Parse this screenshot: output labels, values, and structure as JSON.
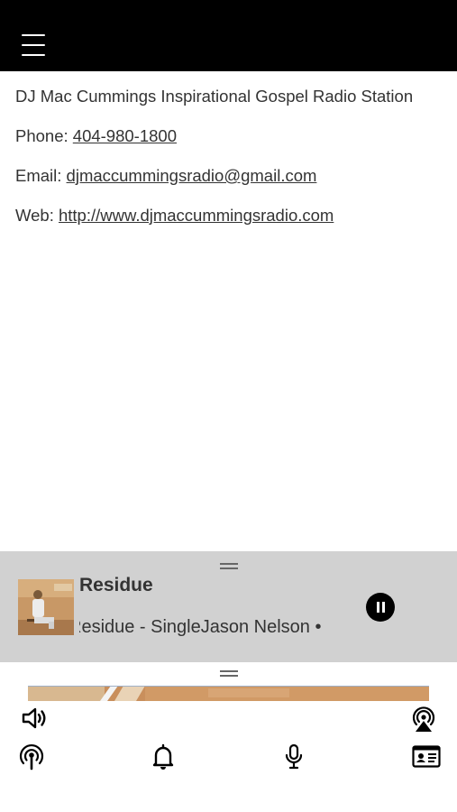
{
  "header": {
    "menu_icon": "hamburger-icon",
    "background": "#000000"
  },
  "contact": {
    "station_name": "DJ Mac Cummings Inspirational Gospel Radio Station",
    "phone_label": "Phone: ",
    "phone": "404-980-1800",
    "email_label": "Email: ",
    "email": "djmaccummingsradio@gmail.com",
    "web_label": "Web: ",
    "web": "http://www.djmaccummingsradio.com"
  },
  "player": {
    "background": "#d1d1d1",
    "title": "Residue",
    "subtitle_scroll": "Residue - SingleJason Nelson •",
    "state": "playing",
    "pause_icon": "pause-icon",
    "cover_icon": "album-cover"
  },
  "bottom_bar": {
    "icons": [
      "volume-icon",
      "airplay-icon",
      "podcast-icon",
      "bell-icon",
      "microphone-icon",
      "contact-card-icon"
    ]
  }
}
